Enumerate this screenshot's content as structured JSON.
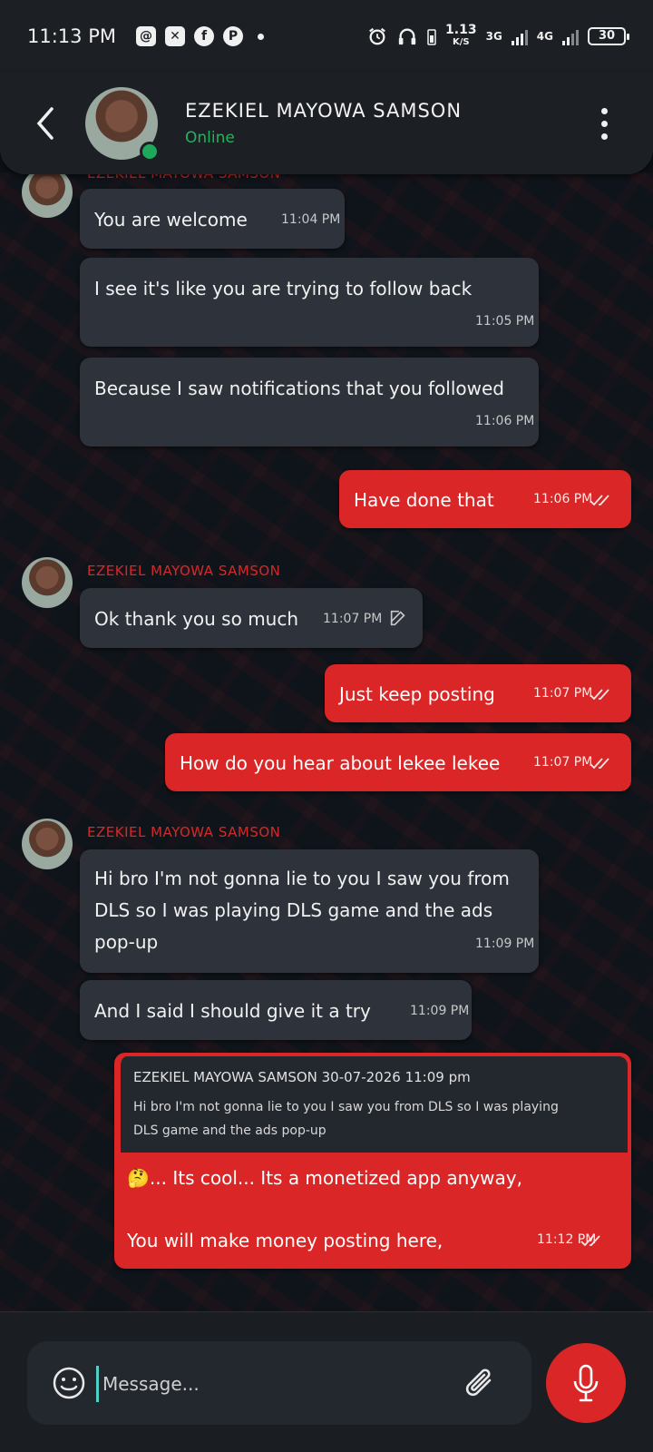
{
  "status_bar": {
    "time": "11:13 PM",
    "speed_value": "1.13",
    "speed_unit": "K/S",
    "net1": "3G",
    "net2": "4G",
    "battery": "30",
    "app_icons": [
      "threads-icon",
      "capcut-icon",
      "facebook-icon",
      "pinterest-icon"
    ]
  },
  "header": {
    "contact_name": "EZEKIEL MAYOWA SAMSON",
    "status": "Online"
  },
  "messages": [
    {
      "text": "You are welcome",
      "time": "11:04 PM",
      "direction": "in"
    },
    {
      "text": "I see it's like you are trying to follow back",
      "time": "11:05 PM",
      "direction": "in"
    },
    {
      "text": "Because I saw notifications that you followed",
      "time": "11:06 PM",
      "direction": "in"
    },
    {
      "text": "Have done that",
      "time": "11:06 PM",
      "direction": "out"
    },
    {
      "sender": "EZEKIEL MAYOWA SAMSON",
      "text": "Ok thank you so much",
      "time": "11:07 PM",
      "direction": "in",
      "edited": true
    },
    {
      "text": "Just keep posting",
      "time": "11:07 PM",
      "direction": "out"
    },
    {
      "text": "How do you hear about lekee lekee",
      "time": "11:07 PM",
      "direction": "out"
    },
    {
      "sender": "EZEKIEL MAYOWA SAMSON",
      "text_lines": [
        "Hi bro I'm not gonna lie to you I saw you from",
        "DLS so I was playing DLS game and the ads",
        "pop-up"
      ],
      "time": "11:09 PM",
      "direction": "in"
    },
    {
      "text": "And I said I should give it a try",
      "time": "11:09 PM",
      "direction": "in"
    },
    {
      "direction": "out",
      "reply_header": "EZEKIEL MAYOWA SAMSON 30-07-2026 11:09 pm",
      "reply_lines": [
        "Hi bro I'm not gonna lie to you I saw you from DLS so I was playing",
        "DLS game and the ads pop-up"
      ],
      "text_line1": "🤔... Its cool... Its a monetized app anyway,",
      "text_line2": "You will make money posting here,",
      "time": "11:12 PM"
    }
  ],
  "top_partial_sender": "EZEKIEL MAYOWA SAMSON",
  "composer": {
    "placeholder": "Message..."
  },
  "colors": {
    "accent": "#da2626",
    "online": "#22b35e",
    "incoming_bubble": "#2d323b",
    "background": "#0f141a"
  }
}
